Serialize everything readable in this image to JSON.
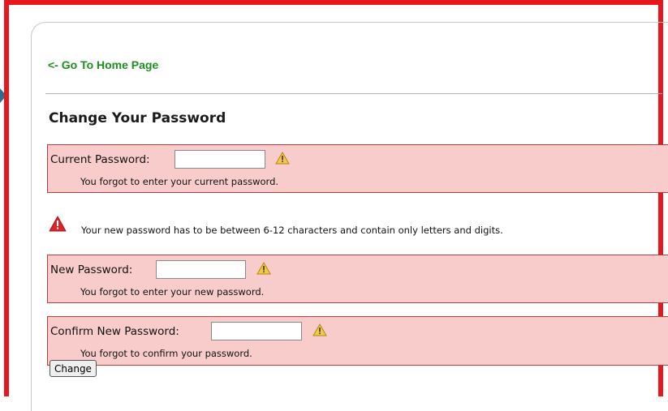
{
  "nav": {
    "home_link": "<- Go To Home Page"
  },
  "form": {
    "title": "Change Your Password",
    "current": {
      "label": "Current Password:",
      "value": "",
      "error": "You forgot to enter your current password."
    },
    "rule_note": "Your new password has to be between 6-12 characters and contain only letters and digits.",
    "new": {
      "label": "New Password:",
      "value": "",
      "error": "You forgot to enter your new password."
    },
    "confirm": {
      "label": "Confirm New Password:",
      "value": "",
      "error": "You forgot to confirm your password."
    },
    "submit_label": "Change"
  },
  "icons": {
    "field_warning": "warning-triangle-icon",
    "rule_warning": "alert-triangle-icon"
  },
  "colors": {
    "frame_border": "#e8171b",
    "error_bg": "#f9cccc",
    "error_border": "#c33a3a",
    "link": "#1e8e1e",
    "alert_icon": "#d7262c",
    "warn_icon": "#f2c94c"
  }
}
